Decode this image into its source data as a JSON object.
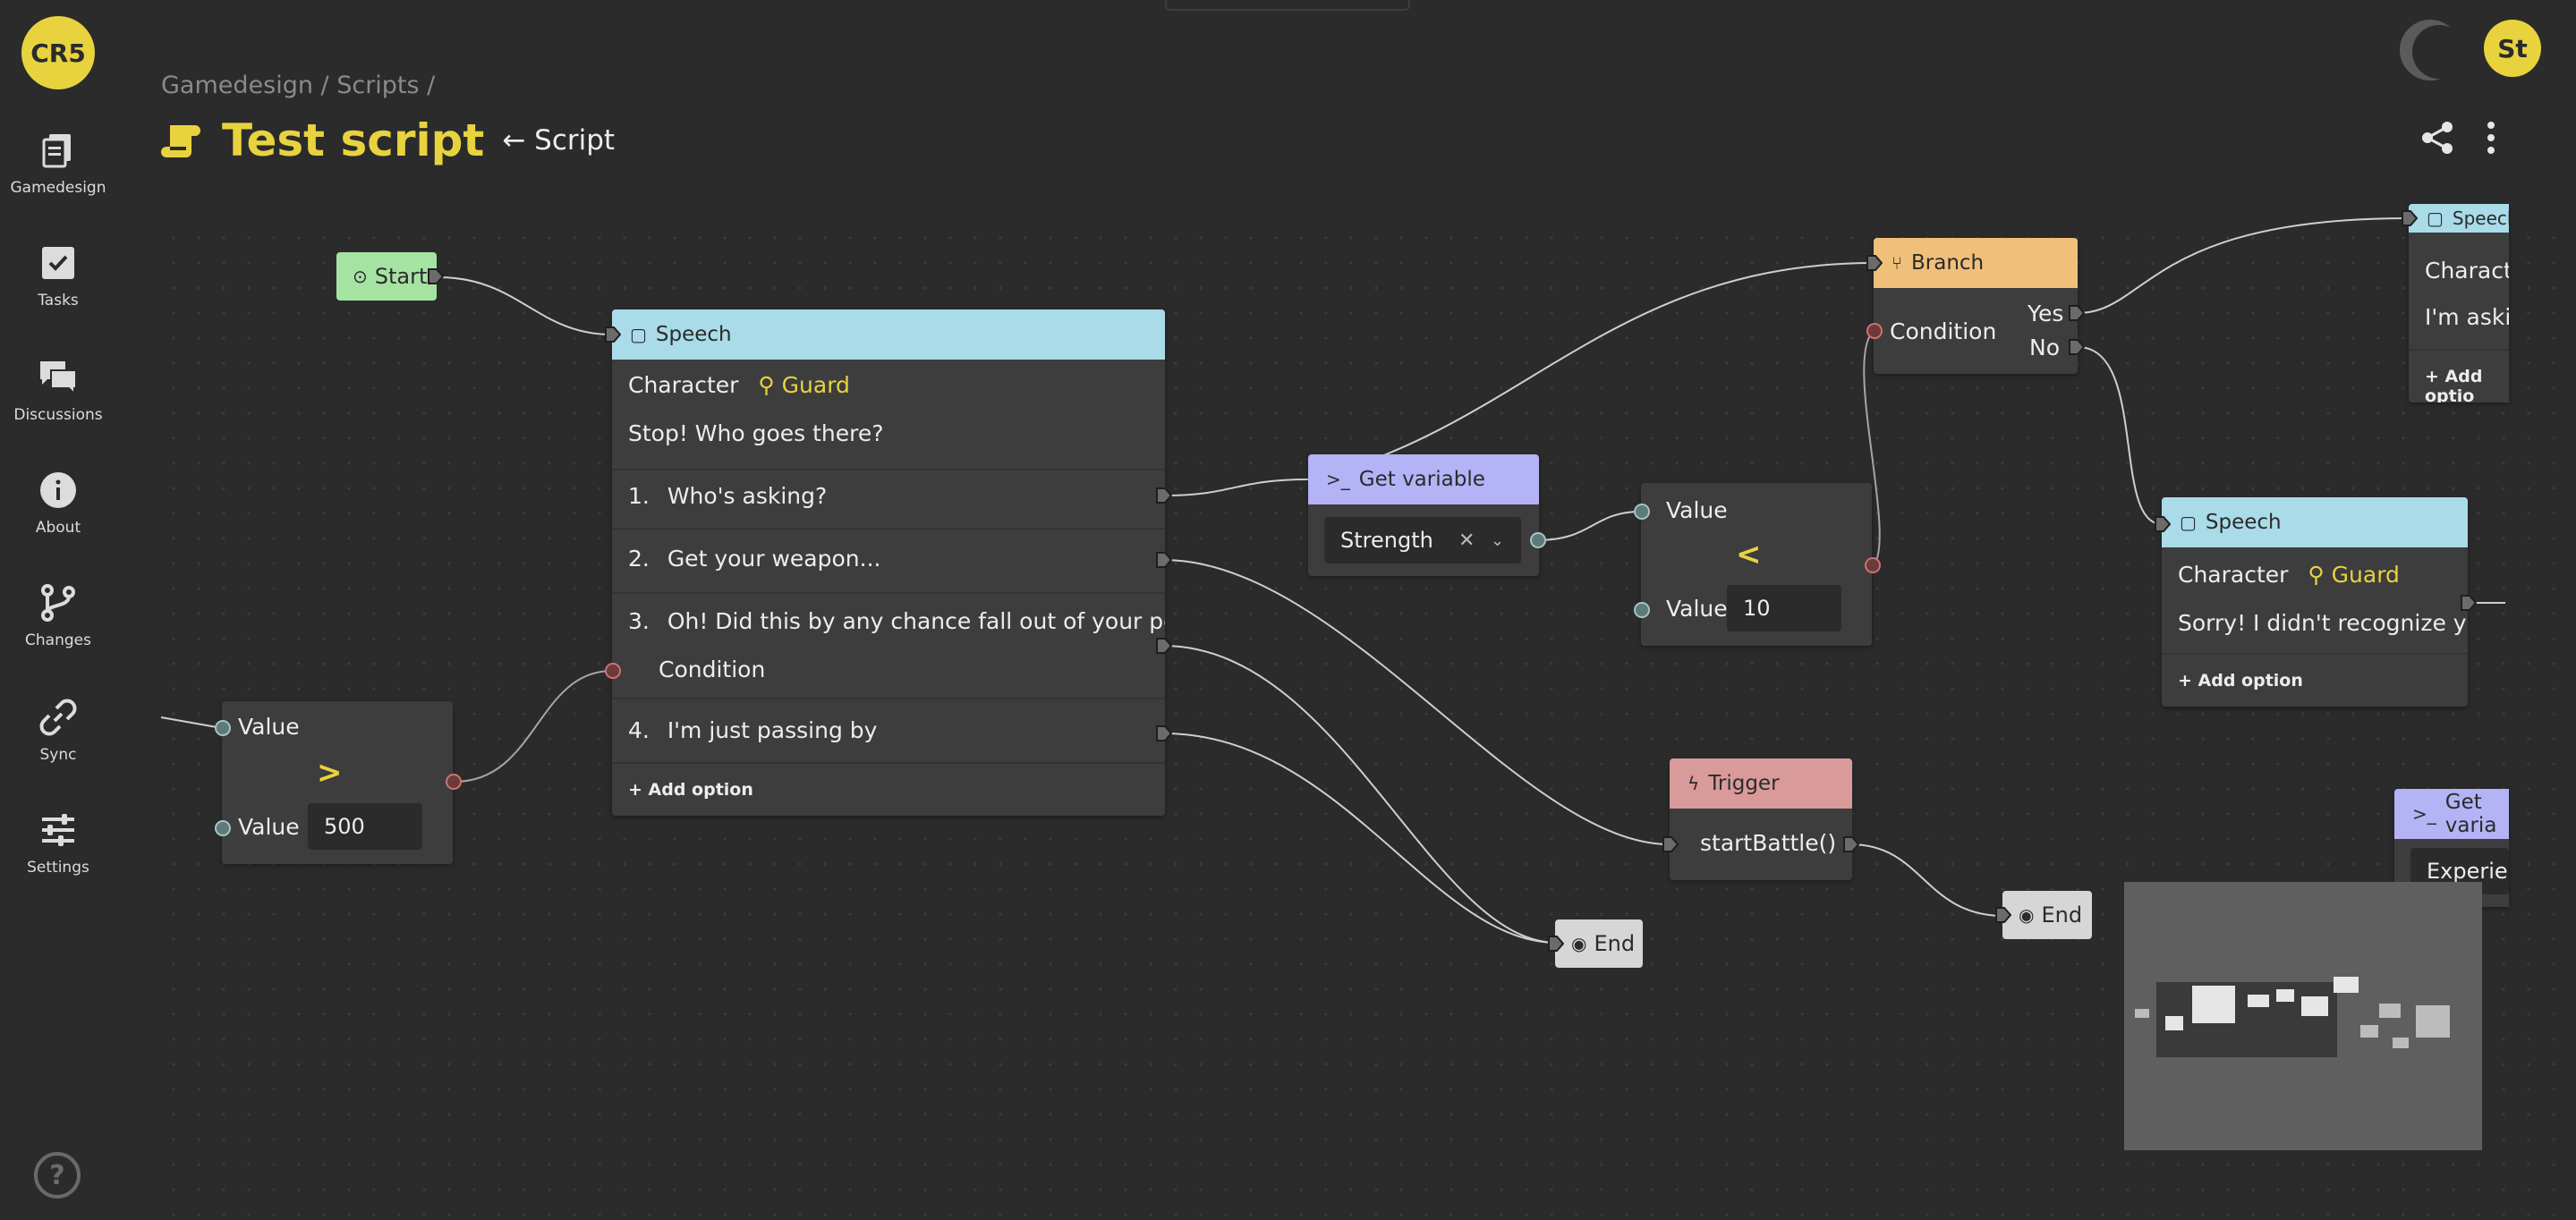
{
  "app": {
    "logo_text": "CR5",
    "avatar_initials": "St"
  },
  "colors": {
    "accent": "#e8d33f",
    "speech_header": "#a9dbe8",
    "branch_header": "#f0bf7a",
    "variable_header": "#b3b3f6",
    "trigger_header": "#d99a9a",
    "start_fill": "#a5e3a3",
    "end_fill": "#d6d6d6"
  },
  "sidebar": {
    "items": [
      {
        "label": "Gamedesign",
        "icon": "copy-pages-icon"
      },
      {
        "label": "Tasks",
        "icon": "checkbox-icon"
      },
      {
        "label": "Discussions",
        "icon": "chat-bubbles-icon"
      },
      {
        "label": "About",
        "icon": "info-icon"
      },
      {
        "label": "Changes",
        "icon": "git-branch-icon"
      },
      {
        "label": "Sync",
        "icon": "link-icon"
      },
      {
        "label": "Settings",
        "icon": "sliders-icon"
      }
    ],
    "help_label": "?"
  },
  "header": {
    "breadcrumb": "Gamedesign / Scripts /",
    "title": "Test script",
    "back_link": "← Script"
  },
  "nodes": {
    "start": {
      "label": "Start"
    },
    "speech1": {
      "header": "Speech",
      "character_label": "Character",
      "character_name": "Guard",
      "line": "Stop! Who goes there?",
      "options": [
        {
          "num": "1.",
          "text": "Who's asking?"
        },
        {
          "num": "2.",
          "text": "Get your weapon..."
        },
        {
          "num": "3.",
          "text": "Oh! Did this by any chance fall out of your pocket?",
          "extra": "Condition"
        },
        {
          "num": "4.",
          "text": "I'm just passing by"
        }
      ],
      "add_option": "+ Add option"
    },
    "compare_gt": {
      "value_label_1": "Value",
      "operator": ">",
      "value_label_2": "Value",
      "input_value": "500"
    },
    "get_variable": {
      "header": "Get variable",
      "selected": "Strength"
    },
    "compare_lt": {
      "value_label_1": "Value",
      "operator": "<",
      "value_label_2": "Value",
      "input_value": "10"
    },
    "branch": {
      "header": "Branch",
      "condition_label": "Condition",
      "yes_label": "Yes",
      "no_label": "No"
    },
    "speech_top_right": {
      "header": "Speech",
      "character_label": "Characte",
      "line": "I'm askin",
      "add_option": "+ Add optio"
    },
    "speech2": {
      "header": "Speech",
      "character_label": "Character",
      "character_name": "Guard",
      "line": "Sorry! I didn't recognize you",
      "add_option": "+ Add option"
    },
    "trigger": {
      "header": "Trigger",
      "function": "startBattle()"
    },
    "end1": {
      "label": "End"
    },
    "end2": {
      "label": "End"
    },
    "get_variable_right": {
      "header": "Get varia",
      "selected": "Experien"
    }
  }
}
